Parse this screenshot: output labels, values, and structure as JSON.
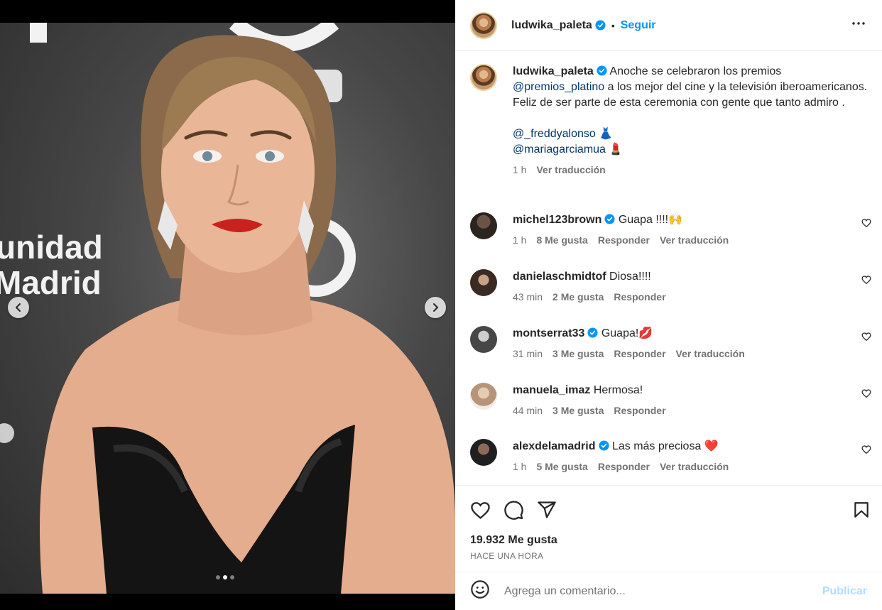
{
  "header": {
    "username": "ludwika_paleta",
    "separator": "•",
    "follow_label": "Seguir"
  },
  "media": {
    "backdrop_text_1": "unidad",
    "backdrop_text_2": "Madrid",
    "current_index": 2,
    "total_items": 3
  },
  "caption": {
    "username": "ludwika_paleta",
    "text_1": "Anoche se celebraron los premios",
    "mention_1": "@premios_platino",
    "text_2": "a los mejor del cine y la televisión iberoamericanos. Feliz de ser parte de esta ceremonia con gente que tanto admiro .",
    "mention_2": "@_freddyalonso",
    "emoji_2": "👗",
    "mention_3": "@mariagarciamua",
    "emoji_3": "💄",
    "time": "1 h",
    "translate": "Ver traducción"
  },
  "comments": [
    {
      "username": "michel123brown",
      "verified": true,
      "text": "Guapa !!!!🙌",
      "time": "1 h",
      "likes": "8 Me gusta",
      "reply": "Responder",
      "translate": "Ver traducción"
    },
    {
      "username": "danielaschmidtof",
      "verified": false,
      "text": "Diosa!!!!",
      "time": "43 min",
      "likes": "2 Me gusta",
      "reply": "Responder",
      "translate": ""
    },
    {
      "username": "montserrat33",
      "verified": true,
      "text": "Guapa!💋",
      "time": "31 min",
      "likes": "3 Me gusta",
      "reply": "Responder",
      "translate": "Ver traducción"
    },
    {
      "username": "manuela_imaz",
      "verified": false,
      "text": "Hermosa!",
      "time": "44 min",
      "likes": "3 Me gusta",
      "reply": "Responder",
      "translate": ""
    },
    {
      "username": "alexdelamadrid",
      "verified": true,
      "text": "Las más preciosa ❤️",
      "time": "1 h",
      "likes": "5 Me gusta",
      "reply": "Responder",
      "translate": "Ver traducción"
    }
  ],
  "footer": {
    "likes": "19.932 Me gusta",
    "when": "HACE UNA HORA",
    "comment_placeholder": "Agrega un comentario...",
    "publish_label": "Publicar"
  },
  "icons": {
    "verified": "verified-badge-icon",
    "more": "more-options-icon",
    "like": "heart-icon",
    "comment": "comment-icon",
    "share": "share-icon",
    "save": "bookmark-icon",
    "emoji": "emoji-icon",
    "prev": "chevron-left-icon",
    "next": "chevron-right-icon"
  },
  "colors": {
    "link_blue": "#0095f6",
    "mention": "#00376b",
    "verified": "#0095f6",
    "publish_disabled": "#b3dbff",
    "lipstick": "#c9221e"
  }
}
